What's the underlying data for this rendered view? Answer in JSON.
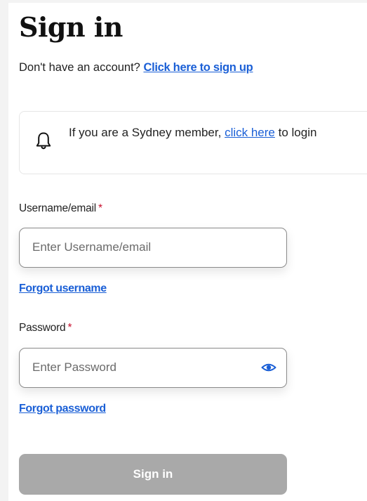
{
  "title": "Sign in",
  "signup": {
    "prompt": "Don't have an account?",
    "link": "Click here to sign up"
  },
  "notice": {
    "icon": "bell-icon",
    "text_before": "If you are a Sydney member,",
    "link": "click here",
    "text_after": "to login"
  },
  "username": {
    "label": "Username/email",
    "required_mark": "*",
    "placeholder": "Enter Username/email",
    "value": ""
  },
  "forgot_username": "Forgot username",
  "password": {
    "label": "Password",
    "required_mark": "*",
    "placeholder": "Enter Password",
    "value": "",
    "toggle_icon": "eye-icon"
  },
  "forgot_password": "Forgot password",
  "submit": {
    "label": "Sign in",
    "state": "disabled"
  },
  "colors": {
    "link": "#1a5fd6",
    "required": "#c8102e",
    "button_disabled": "#a9a9a9"
  }
}
